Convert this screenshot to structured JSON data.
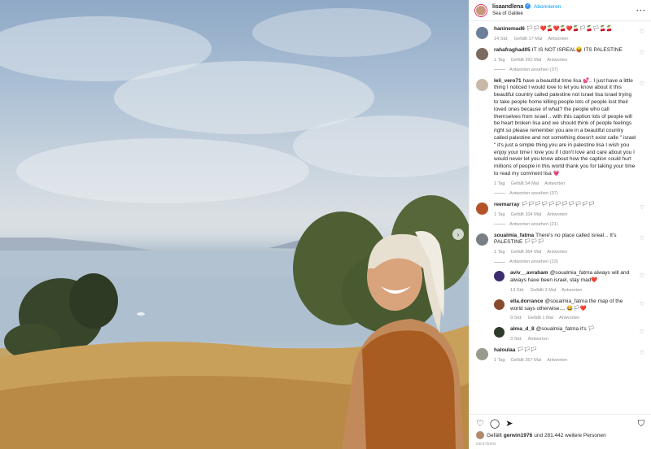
{
  "header": {
    "username": "lisaandlena",
    "follow_label": "Abonnieren",
    "location": "Sea of Galilee"
  },
  "comments": [
    {
      "user": "haninemad6",
      "text": "🏳🏳❤️🍒❤️🍒❤️🍒🏳🍒🏳🍒🍒",
      "time": "14 Std.",
      "likes": "Gefällt 17 Mal",
      "reply": "Antworten",
      "avatar": "#6b7f9a"
    },
    {
      "user": "rahafraghad05",
      "text": "IT IS NOT ISREAL😝 ITS PALESTINE",
      "time": "1 Tag",
      "likes": "Gefällt 292 Mal",
      "reply": "Antworten",
      "view_replies": "Antworten ansehen (37)",
      "avatar": "#7b6a5e"
    },
    {
      "user": "leli_vero71",
      "text": "have a beautiful time lisa 💕.. I just have a little thing I noticed I would love to let you know about it this beautiful country called palestine not israel lisa israel trying to take people home killing people lots of people lost their loved ones because of what? the people who call themselves from israel .. with this caption lots of people will be heart broken lisa and we should think of people feelings right so please remember you are in a beautiful country called palestine and not something doesn't exist calle \" israel \" it's just a simple thing you are in palestine lisa I wish you enjoy your time I love you if I don't love and care about you I would never let you know about how the caption could hurt millions of people in this world thank you for taking your time to read my comment lisa 💗",
      "time": "1 Tag",
      "likes": "Gefällt 54 Mal",
      "reply": "Antworten",
      "view_replies": "Antworten ansehen (37)",
      "avatar": "#c9b8a8"
    },
    {
      "user": "reemarray",
      "text": "🏳🏳🏳🏳🏳🏳🏳🏳🏳🏳🏳",
      "time": "1 Tag",
      "likes": "Gefällt 104 Mal",
      "reply": "Antworten",
      "view_replies": "Antworten ansehen (21)",
      "avatar": "#b4532a"
    },
    {
      "user": "soualmia_fatma",
      "text": "There's no place called isreal .. It's PALESTINE 🏳🏳🏳",
      "time": "1 Tag",
      "likes": "Gefällt 364 Mal",
      "reply": "Antworten",
      "view_replies": "Antworten ansehen (23)",
      "avatar": "#7a7f85"
    }
  ],
  "replies": [
    {
      "user": "aviv__avraham",
      "text": "@soualmia_fatma always will and always have been israel, stay mad❤️",
      "time": "13 Std.",
      "likes": "Gefällt 3 Mal",
      "reply": "Antworten",
      "avatar": "#3b2d6e"
    },
    {
      "user": "ella.dorrance",
      "text": "@soualmia_fatma the map of the world says otherwise.... 😂🏳❤️",
      "time": "9 Std.",
      "likes": "Gefällt 1 Mal",
      "reply": "Antworten",
      "avatar": "#8a4a2e"
    },
    {
      "user": "alma_d_8",
      "text": "@soualmia_fatma it's 🏳",
      "time": "3 Std.",
      "reply": "Antworten",
      "avatar": "#2f3b2a"
    }
  ],
  "last_comment": {
    "user": "haloulaa",
    "text": "🏳🏳🏳",
    "time": "1 Tag",
    "likes": "Gefällt 357 Mal",
    "reply": "Antworten",
    "avatar": "#9a9a8a"
  },
  "likes_line": {
    "prefix": "Gefällt",
    "user": "gerwin1976",
    "suffix": "und 281.442 weitere Personen"
  },
  "date_label": "GESTERN",
  "icons": {
    "heart": "heart-icon",
    "comment": "comment-icon",
    "share": "share-icon",
    "bookmark": "bookmark-icon",
    "next": "chevron-right-icon",
    "more": "more-icon"
  }
}
